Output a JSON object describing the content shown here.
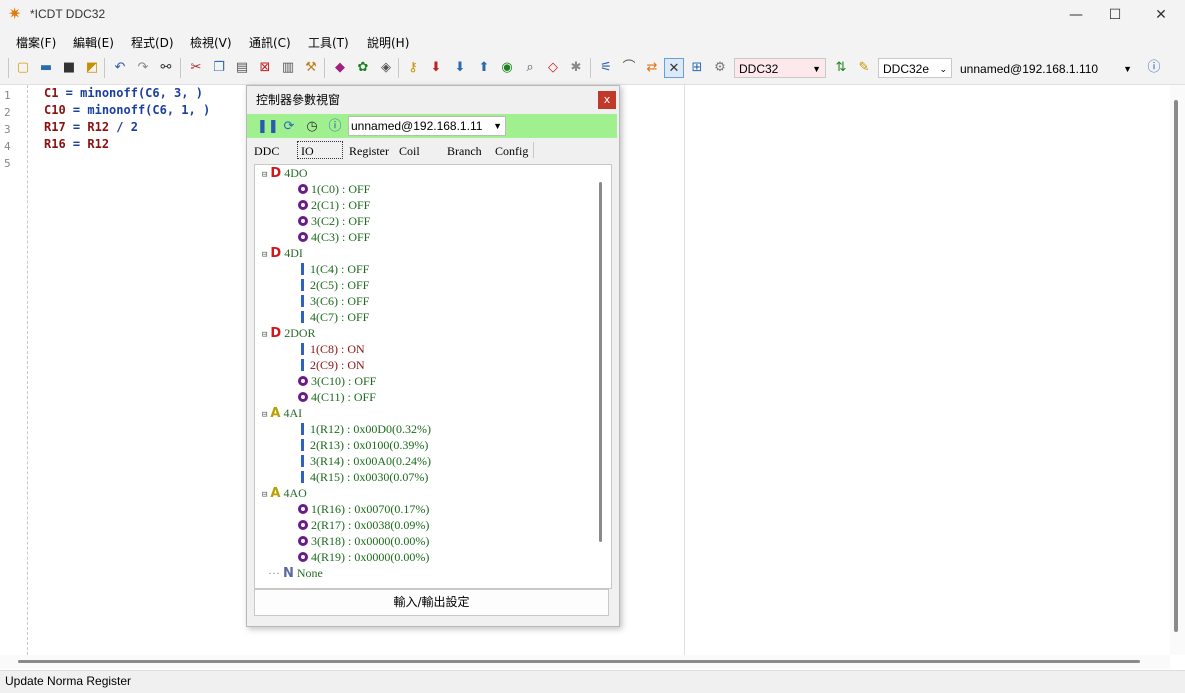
{
  "window": {
    "title": "*ICDT DDC32",
    "min": "—",
    "max": "☐",
    "close": "✕"
  },
  "menu": [
    "檔案(F)",
    "編輯(E)",
    "程式(D)",
    "檢視(V)",
    "通訊(C)",
    "工具(T)",
    "說明(H)"
  ],
  "toolbar": {
    "device_combo": "DDC32",
    "model_combo": "DDC32e",
    "connection_combo": "unnamed@192.168.1.110"
  },
  "editor": {
    "line_numbers": [
      "1",
      "2",
      "3",
      "4",
      "5"
    ],
    "lines": [
      {
        "lhs": "C1",
        "op": " = ",
        "fn": "minonoff",
        "args": "(C6, 3, )"
      },
      {
        "lhs": "C10",
        "op": " = ",
        "fn": "minonoff",
        "args": "(C6, 1, )"
      },
      {
        "lhs": "R17",
        "op": " = ",
        "fn": "R12",
        "args": " / 2"
      },
      {
        "lhs": "R16",
        "op": " = ",
        "fn": "R12",
        "args": ""
      }
    ]
  },
  "panel": {
    "title": "控制器參數視窗",
    "close": "x",
    "connection": "unnamed@192.168.1.11",
    "tabs": [
      "DDC",
      "IO",
      "Register",
      "Coil",
      "Branch",
      "Config"
    ],
    "groups": [
      {
        "icon": "D",
        "name": "4DO",
        "items": [
          {
            "kind": "coil",
            "text": "1(C0) : OFF"
          },
          {
            "kind": "coil",
            "text": "2(C1) : OFF"
          },
          {
            "kind": "coil",
            "text": "3(C2) : OFF"
          },
          {
            "kind": "coil",
            "text": "4(C3) : OFF"
          }
        ]
      },
      {
        "icon": "D",
        "name": "4DI",
        "items": [
          {
            "kind": "bar",
            "text": "1(C4) : OFF"
          },
          {
            "kind": "bar",
            "text": "2(C5) : OFF"
          },
          {
            "kind": "bar",
            "text": "3(C6) : OFF"
          },
          {
            "kind": "bar",
            "text": "4(C7) : OFF"
          }
        ]
      },
      {
        "icon": "D",
        "name": "2DOR",
        "items": [
          {
            "kind": "bar",
            "text": "1(C8) : ON"
          },
          {
            "kind": "bar",
            "text": "2(C9) : ON"
          },
          {
            "kind": "coil",
            "text": "3(C10) : OFF"
          },
          {
            "kind": "coil",
            "text": "4(C11) : OFF"
          }
        ]
      },
      {
        "icon": "A",
        "name": "4AI",
        "items": [
          {
            "kind": "bar",
            "text": "1(R12) : 0x00D0(0.32%)"
          },
          {
            "kind": "bar",
            "text": "2(R13) : 0x0100(0.39%)"
          },
          {
            "kind": "bar",
            "text": "3(R14) : 0x00A0(0.24%)"
          },
          {
            "kind": "bar",
            "text": "4(R15) : 0x0030(0.07%)"
          }
        ]
      },
      {
        "icon": "A",
        "name": "4AO",
        "items": [
          {
            "kind": "coil",
            "text": "1(R16) : 0x0070(0.17%)"
          },
          {
            "kind": "coil",
            "text": "2(R17) : 0x0038(0.09%)"
          },
          {
            "kind": "coil",
            "text": "3(R18) : 0x0000(0.00%)"
          },
          {
            "kind": "coil",
            "text": "4(R19) : 0x0000(0.00%)"
          }
        ]
      }
    ],
    "none_label": "None",
    "io_button": "輸入/輸出設定"
  },
  "status": "Update Norma Register"
}
